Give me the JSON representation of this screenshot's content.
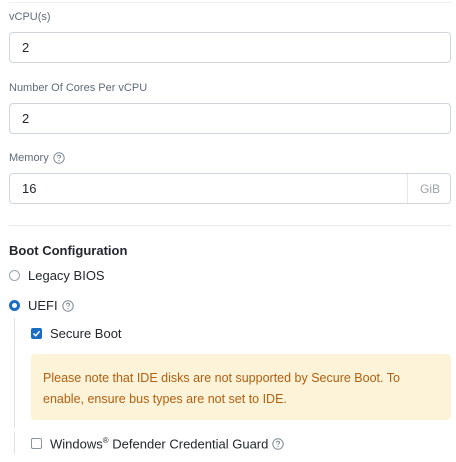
{
  "vcpus": {
    "label": "vCPU(s)",
    "value": "2"
  },
  "cores": {
    "label": "Number Of Cores Per vCPU",
    "value": "2"
  },
  "memory": {
    "label": "Memory",
    "value": "16",
    "unit": "GiB",
    "help_icon": "question-circle-icon"
  },
  "boot": {
    "title": "Boot Configuration",
    "legacy_bios": {
      "label": "Legacy BIOS",
      "selected": false
    },
    "uefi": {
      "label": "UEFI",
      "selected": true,
      "help_icon": "question-circle-icon"
    },
    "secure_boot": {
      "label": "Secure Boot",
      "checked": true
    },
    "alert_text": "Please note that IDE disks are not supported by Secure Boot. To enable, ensure bus types are not set to IDE.",
    "credential_guard": {
      "label_prefix": "Windows",
      "trademark": "®",
      "label_suffix": " Defender Credential Guard",
      "checked": false,
      "help_icon": "question-circle-icon"
    }
  },
  "colors": {
    "accent": "#1b6dc1",
    "warning_bg": "#fdf3d8",
    "warning_text": "#b15f10"
  }
}
